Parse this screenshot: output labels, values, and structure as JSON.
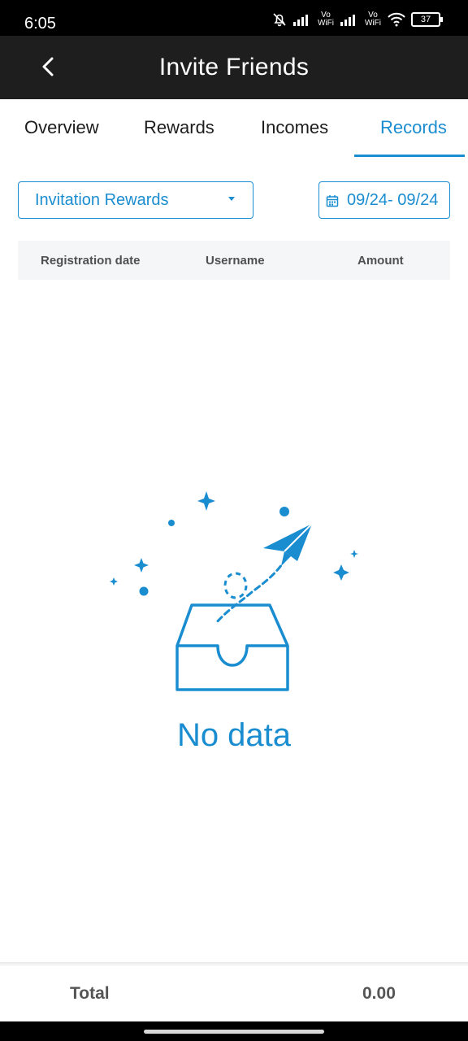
{
  "status_bar": {
    "time": "6:05",
    "vowifi_1_top": "Vo",
    "vowifi_1_bottom": "WiFi",
    "vowifi_2_top": "Vo",
    "vowifi_2_bottom": "WiFi",
    "battery": "37"
  },
  "header": {
    "title": "Invite Friends",
    "back_icon": "chevron-left-icon"
  },
  "tabs": [
    {
      "label": "Overview",
      "active": false
    },
    {
      "label": "Rewards",
      "active": false
    },
    {
      "label": "Incomes",
      "active": false
    },
    {
      "label": "Records",
      "active": true
    }
  ],
  "filters": {
    "type_select": "Invitation Rewards",
    "date_range": "09/24- 09/24"
  },
  "table": {
    "columns": [
      "Registration date",
      "Username",
      "Amount"
    ],
    "rows": []
  },
  "empty_state": {
    "text": "No data",
    "icon": "empty-inbox-paper-plane-icon"
  },
  "footer": {
    "total_label": "Total",
    "total_value": "0.00"
  },
  "colors": {
    "accent": "#1a8dd0",
    "header_bg": "#1e1e1e",
    "table_header_bg": "#f4f6f8"
  }
}
